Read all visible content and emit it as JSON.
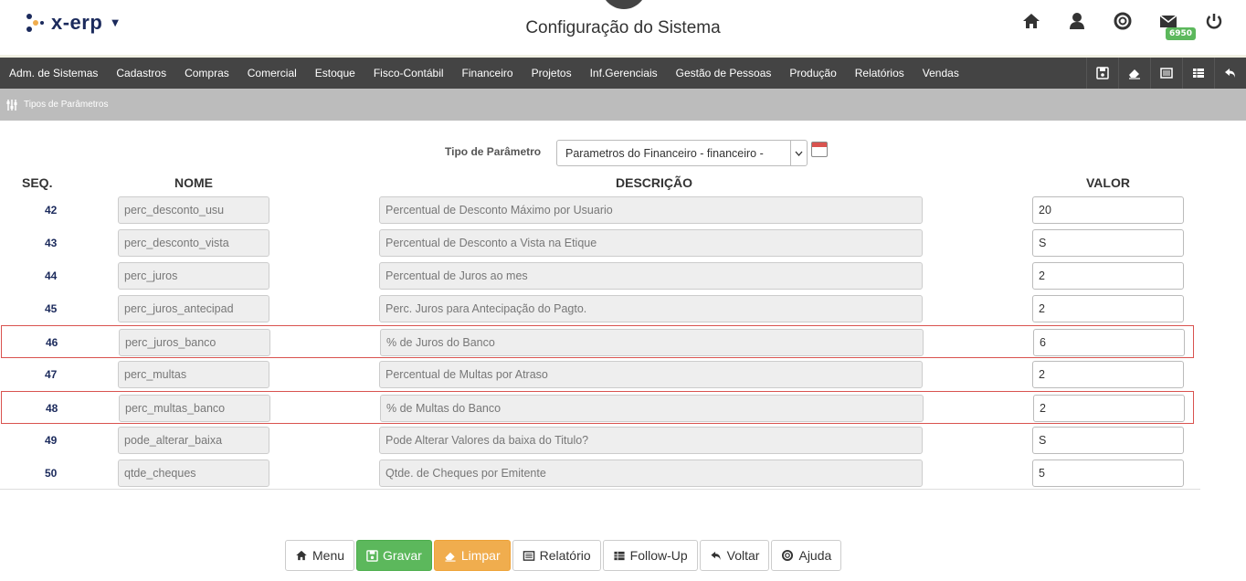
{
  "header": {
    "logo_text": "x-erp",
    "page_title": "Configuração do Sistema",
    "mail_badge": "6950"
  },
  "menu": {
    "items": [
      "Adm. de Sistemas",
      "Cadastros",
      "Compras",
      "Comercial",
      "Estoque",
      "Fisco-Contábil",
      "Financeiro",
      "Projetos",
      "Inf.Gerenciais",
      "Gestão de Pessoas",
      "Produção",
      "Relatórios",
      "Vendas"
    ]
  },
  "breadcrumb": "Tipos de Parâmetros",
  "filter": {
    "label": "Tipo de Parâmetro",
    "selected": "Parametros do Financeiro - financeiro -"
  },
  "table": {
    "headers": {
      "seq": "SEQ.",
      "nome": "NOME",
      "descricao": "DESCRIÇÃO",
      "valor": "VALOR"
    },
    "rows": [
      {
        "seq": "42",
        "nome": "perc_desconto_usu",
        "descricao": "Percentual de Desconto Máximo por Usuario",
        "valor": "20",
        "highlighted": false
      },
      {
        "seq": "43",
        "nome": "perc_desconto_vista",
        "descricao": "Percentual de Desconto a Vista na Etique",
        "valor": "S",
        "highlighted": false
      },
      {
        "seq": "44",
        "nome": "perc_juros",
        "descricao": "Percentual de Juros ao mes",
        "valor": "2",
        "highlighted": false
      },
      {
        "seq": "45",
        "nome": "perc_juros_antecipad",
        "descricao": "Perc. Juros para Antecipação do Pagto.",
        "valor": "2",
        "highlighted": false
      },
      {
        "seq": "46",
        "nome": "perc_juros_banco",
        "descricao": "% de Juros do Banco",
        "valor": "6",
        "highlighted": true
      },
      {
        "seq": "47",
        "nome": "perc_multas",
        "descricao": "Percentual de Multas por Atraso",
        "valor": "2",
        "highlighted": false
      },
      {
        "seq": "48",
        "nome": "perc_multas_banco",
        "descricao": "% de Multas do Banco",
        "valor": "2",
        "highlighted": true
      },
      {
        "seq": "49",
        "nome": "pode_alterar_baixa",
        "descricao": "Pode Alterar Valores da baixa do Titulo?",
        "valor": "S",
        "highlighted": false
      },
      {
        "seq": "50",
        "nome": "qtde_cheques",
        "descricao": "Qtde. de Cheques por Emitente",
        "valor": "5",
        "highlighted": false
      }
    ]
  },
  "buttons": {
    "menu": "Menu",
    "gravar": "Gravar",
    "limpar": "Limpar",
    "relatorio": "Relatório",
    "followup": "Follow-Up",
    "voltar": "Voltar",
    "ajuda": "Ajuda"
  },
  "colors": {
    "brand": "#1b2a5c",
    "menubar": "#444444",
    "highlight_border": "#d9534f",
    "save": "#5cb85c",
    "clear": "#f0ad4e"
  }
}
